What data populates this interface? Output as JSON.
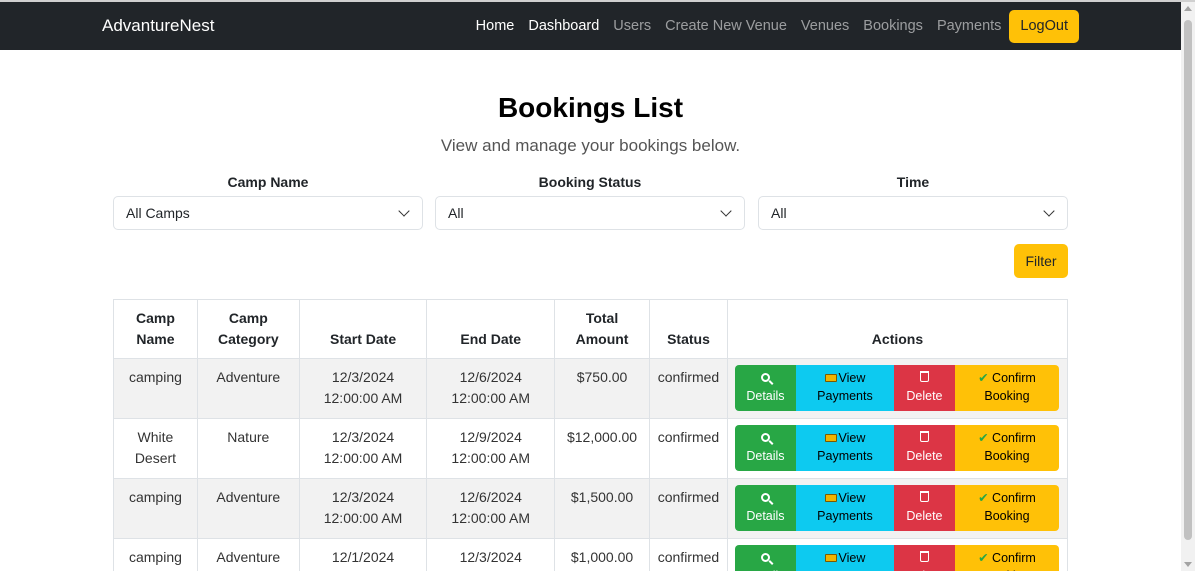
{
  "navbar": {
    "brand": "AdvantureNest",
    "links": [
      "Home",
      "Dashboard",
      "Users",
      "Create New Venue",
      "Venues",
      "Bookings",
      "Payments"
    ],
    "logout_label": "LogOut"
  },
  "page": {
    "title": "Bookings List",
    "subtitle": "View and manage your bookings below."
  },
  "filters": {
    "camp_name": {
      "label": "Camp Name",
      "value": "All Camps"
    },
    "booking_status": {
      "label": "Booking Status",
      "value": "All"
    },
    "time": {
      "label": "Time",
      "value": "All"
    },
    "filter_label": "Filter"
  },
  "table": {
    "headers": {
      "camp_name_1": "Camp",
      "camp_name_2": "Name",
      "camp_category_1": "Camp",
      "camp_category_2": "Category",
      "start_date": "Start Date",
      "end_date": "End Date",
      "total_1": "Total",
      "total_2": "Amount",
      "status": "Status",
      "actions": "Actions"
    },
    "action_labels": {
      "details": "Details",
      "view_1": "View",
      "view_2": "Payments",
      "delete": "Delete",
      "confirm_1": "Confirm",
      "confirm_2": "Booking"
    },
    "rows": [
      {
        "name_1": "camping",
        "name_2": "",
        "category": "Adventure",
        "start_1": "12/3/2024",
        "start_2": "12:00:00 AM",
        "end_1": "12/6/2024",
        "end_2": "12:00:00 AM",
        "amount": "$750.00",
        "status": "confirmed"
      },
      {
        "name_1": "White",
        "name_2": "Desert",
        "category": "Nature",
        "start_1": "12/3/2024",
        "start_2": "12:00:00 AM",
        "end_1": "12/9/2024",
        "end_2": "12:00:00 AM",
        "amount": "$12,000.00",
        "status": "confirmed"
      },
      {
        "name_1": "camping",
        "name_2": "",
        "category": "Adventure",
        "start_1": "12/3/2024",
        "start_2": "12:00:00 AM",
        "end_1": "12/6/2024",
        "end_2": "12:00:00 AM",
        "amount": "$1,500.00",
        "status": "confirmed"
      },
      {
        "name_1": "camping",
        "name_2": "",
        "category": "Adventure",
        "start_1": "12/1/2024",
        "start_2": "",
        "end_1": "12/3/2024",
        "end_2": "",
        "amount": "$1,000.00",
        "status": "confirmed"
      }
    ]
  },
  "colors": {
    "navbar_bg": "#212529",
    "warning": "#ffc107",
    "success": "#28a745",
    "info": "#0dcaf0",
    "danger": "#dc3545"
  },
  "icons": {
    "details": "magnifier-icon",
    "view_payments": "credit-card-icon",
    "delete": "trash-icon",
    "confirm": "checkmark-icon"
  }
}
